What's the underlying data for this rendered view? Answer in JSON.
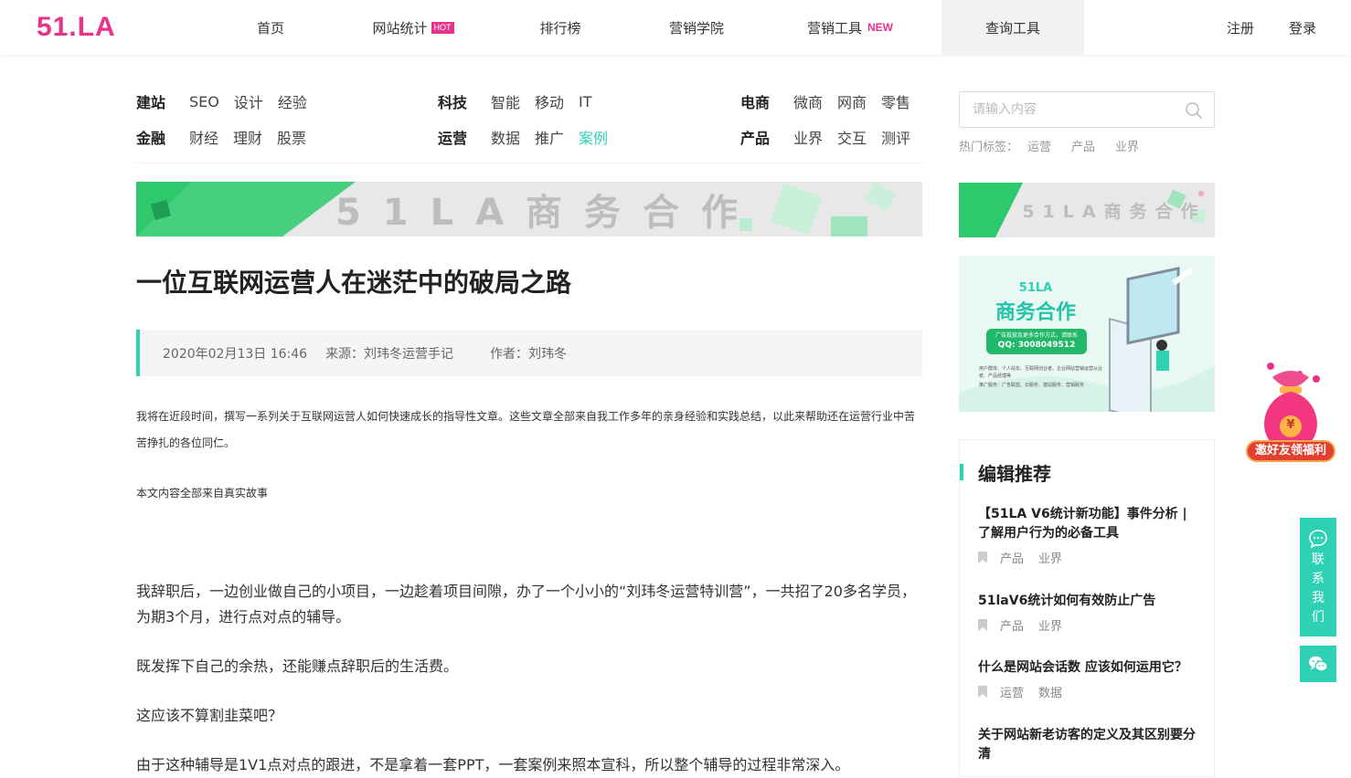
{
  "header": {
    "logo": "51.LA",
    "nav": [
      {
        "label": "首页"
      },
      {
        "label": "网站统计",
        "badge": "HOT"
      },
      {
        "label": "排行榜"
      },
      {
        "label": "营销学院"
      },
      {
        "label": "营销工具",
        "badge": "NEW"
      },
      {
        "label": "查询工具",
        "active": true
      }
    ],
    "register": "注册",
    "login": "登录"
  },
  "categories": [
    {
      "head": "建站",
      "links": [
        "SEO",
        "设计",
        "经验"
      ]
    },
    {
      "head": "科技",
      "links": [
        "智能",
        "移动",
        "IT"
      ]
    },
    {
      "head": "电商",
      "links": [
        "微商",
        "网商",
        "零售"
      ]
    },
    {
      "head": "金融",
      "links": [
        "财经",
        "理财",
        "股票"
      ]
    },
    {
      "head": "运营",
      "links": [
        "数据",
        "推广",
        "案例"
      ],
      "highlight": "案例"
    },
    {
      "head": "产品",
      "links": [
        "业界",
        "交互",
        "测评"
      ]
    }
  ],
  "search": {
    "placeholder": "请输入内容",
    "hot_label": "热门标签：",
    "hot_tags": [
      "运营",
      "产品",
      "业界"
    ]
  },
  "banner": {
    "wide_text": "51LA商务合作",
    "side_text": "51LA商务合作"
  },
  "ad": {
    "brand": "51LA",
    "title": "商务合作",
    "button_text": "广告投放及更多合作方式，请联系",
    "qq": "QQ: 3008049512",
    "line1": "用户群体：个人站长、互联网创业者、企业网站营销运营从业者、产品经理等",
    "line2": "推广服务：广告联盟、云服务、建站服务、营销服务"
  },
  "article": {
    "title": "一位互联网运营人在迷茫中的破局之路",
    "date": "2020年02月13日 16:46",
    "source": "来源：刘玮冬运营手记",
    "author": "作者：刘玮冬",
    "intro": "我将在近段时间，撰写一系列关于互联网运营人如何快速成长的指导性文章。这些文章全部来自我工作多年的亲身经验和实践总结，以此来帮助还在运营行业中苦苦挣扎的各位同仁。",
    "note": "本文内容全部来自真实故事",
    "p1": "我辞职后，一边创业做自己的小项目，一边趁着项目间隙，办了一个小小的“刘玮冬运营特训营”，一共招了20多名学员，为期3个月，进行点对点的辅导。",
    "p2": "既发挥下自己的余热，还能赚点辞职后的生活费。",
    "p3": "这应该不算割韭菜吧？",
    "p4": "由于这种辅导是1V1点对点的跟进，不是拿着一套PPT，一套案例来照本宣科，所以整个辅导的过程非常深入。"
  },
  "recommend": {
    "title": "编辑推荐",
    "items": [
      {
        "title": "【51LA V6统计新功能】事件分析 | 了解用户行为的必备工具",
        "tags": [
          "产品",
          "业界"
        ]
      },
      {
        "title": "51laV6统计如何有效防止广告",
        "tags": [
          "产品",
          "业界"
        ]
      },
      {
        "title": "什么是网站会话数 应该如何运用它？",
        "tags": [
          "运营",
          "数据"
        ]
      },
      {
        "title": "关于网站新老访客的定义及其区别要分清",
        "tags": []
      }
    ]
  },
  "floating": {
    "gift_label": "邀好友领福利",
    "gift_symbol": "¥",
    "contact_chars": [
      "联",
      "系",
      "我",
      "们"
    ]
  },
  "colors": {
    "brand": "#e8338a",
    "accent": "#2fd1b5"
  }
}
